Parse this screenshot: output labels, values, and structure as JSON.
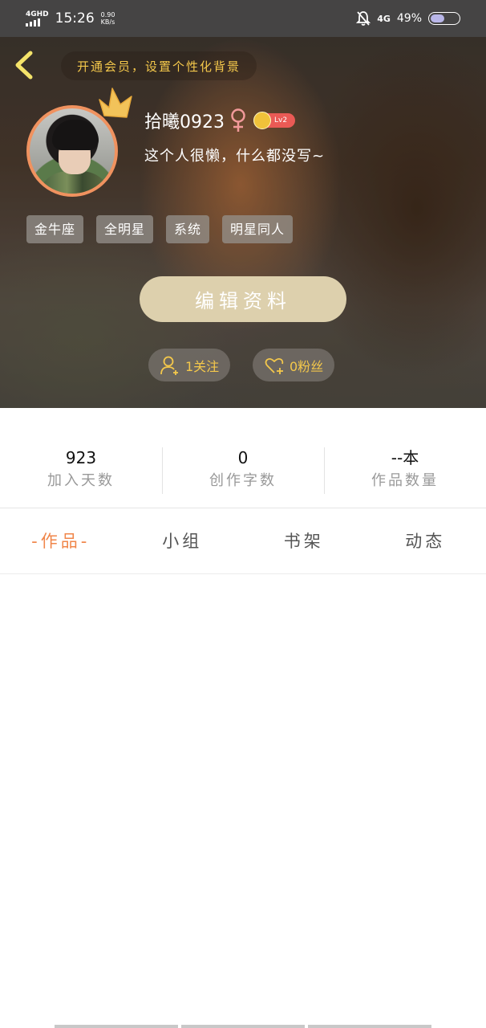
{
  "status_bar": {
    "network": "4GHD",
    "time": "15:26",
    "speed_value": "0.90",
    "speed_unit": "KB/s",
    "net_type": "4G",
    "battery": "49%",
    "battery_level": 0.49
  },
  "header": {
    "vip_banner": "开通会员，设置个性化背景",
    "username": "拾曦0923",
    "level": "Lv2",
    "bio": "这个人很懒，什么都没写~",
    "tags": [
      "金牛座",
      "全明星",
      "系统",
      "明星同人"
    ],
    "edit_label": "编辑资料",
    "following_label": "1关注",
    "fans_label": "0粉丝"
  },
  "stats": [
    {
      "value": "923",
      "label": "加入天数"
    },
    {
      "value": "0",
      "label": "创作字数"
    },
    {
      "value": "--本",
      "label": "作品数量"
    }
  ],
  "tabs": [
    {
      "label": "-作品-",
      "active": true
    },
    {
      "label": "小组",
      "active": false
    },
    {
      "label": "书架",
      "active": false
    },
    {
      "label": "动态",
      "active": false
    }
  ],
  "colors": {
    "accent": "#f0864a",
    "gold": "#f4c84b",
    "edit_button": "#ddd0ad"
  }
}
